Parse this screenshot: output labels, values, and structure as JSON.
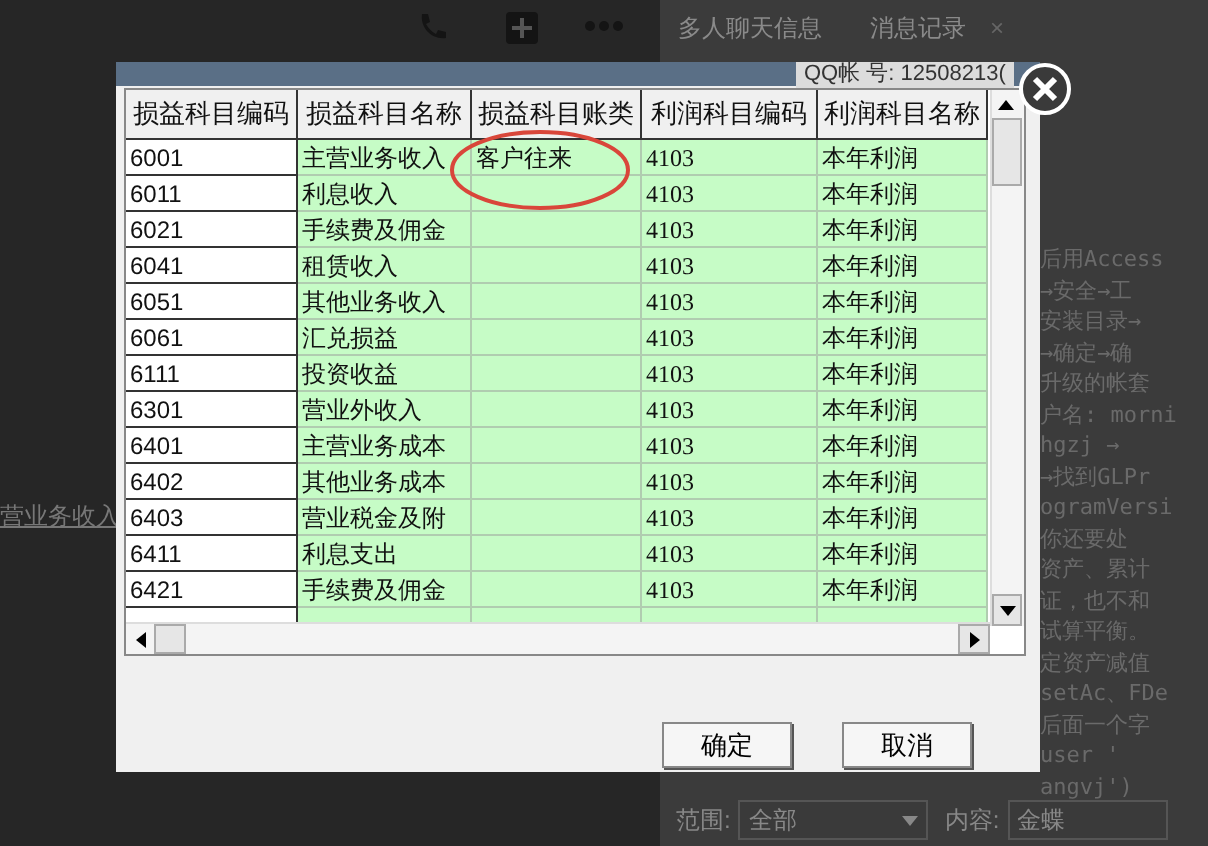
{
  "background": {
    "tabs": [
      {
        "label": "多人聊天信息"
      },
      {
        "label": "消息记录"
      }
    ],
    "close_tab": "×",
    "account": "QQ帐 号: 12508213(",
    "left_text": "营业务收入",
    "note_lines": [
      "后用Access",
      "→安全→工",
      "安装目录→",
      "→确定→确",
      "升级的帐套",
      "户名: morni",
      "hgzj  →",
      "→找到GLPr",
      "ogramVersi",
      "你还要处",
      "资产、累计",
      "证，也不和",
      "试算平衡。",
      "定资产减值",
      "setAc、FDe",
      "后面一个字",
      "user  '",
      "angvj')"
    ],
    "search": {
      "scope_label": "范围:",
      "scope_value": "全部",
      "content_label": "内容:",
      "content_value": "金蝶"
    }
  },
  "dialog": {
    "table": {
      "columns": [
        "损益科目编码",
        "损益科目名称",
        "损益科目账类",
        "利润科目编码",
        "利润科目名称"
      ],
      "rows": [
        [
          "6001",
          "主营业务收入",
          "客户往来",
          "4103",
          "本年利润"
        ],
        [
          "6011",
          "利息收入",
          "",
          "4103",
          "本年利润"
        ],
        [
          "6021",
          "手续费及佣金",
          "",
          "4103",
          "本年利润"
        ],
        [
          "6041",
          "租赁收入",
          "",
          "4103",
          "本年利润"
        ],
        [
          "6051",
          "其他业务收入",
          "",
          "4103",
          "本年利润"
        ],
        [
          "6061",
          "汇兑损益",
          "",
          "4103",
          "本年利润"
        ],
        [
          "6111",
          "投资收益",
          "",
          "4103",
          "本年利润"
        ],
        [
          "6301",
          "营业外收入",
          "",
          "4103",
          "本年利润"
        ],
        [
          "6401",
          "主营业务成本",
          "",
          "4103",
          "本年利润"
        ],
        [
          "6402",
          "其他业务成本",
          "",
          "4103",
          "本年利润"
        ],
        [
          "6403",
          "营业税金及附",
          "",
          "4103",
          "本年利润"
        ],
        [
          "6411",
          "利息支出",
          "",
          "4103",
          "本年利润"
        ],
        [
          "6421",
          "手续费及佣金",
          "",
          "4103",
          "本年利润"
        ]
      ]
    },
    "buttons": [
      "确定",
      "取消"
    ]
  }
}
